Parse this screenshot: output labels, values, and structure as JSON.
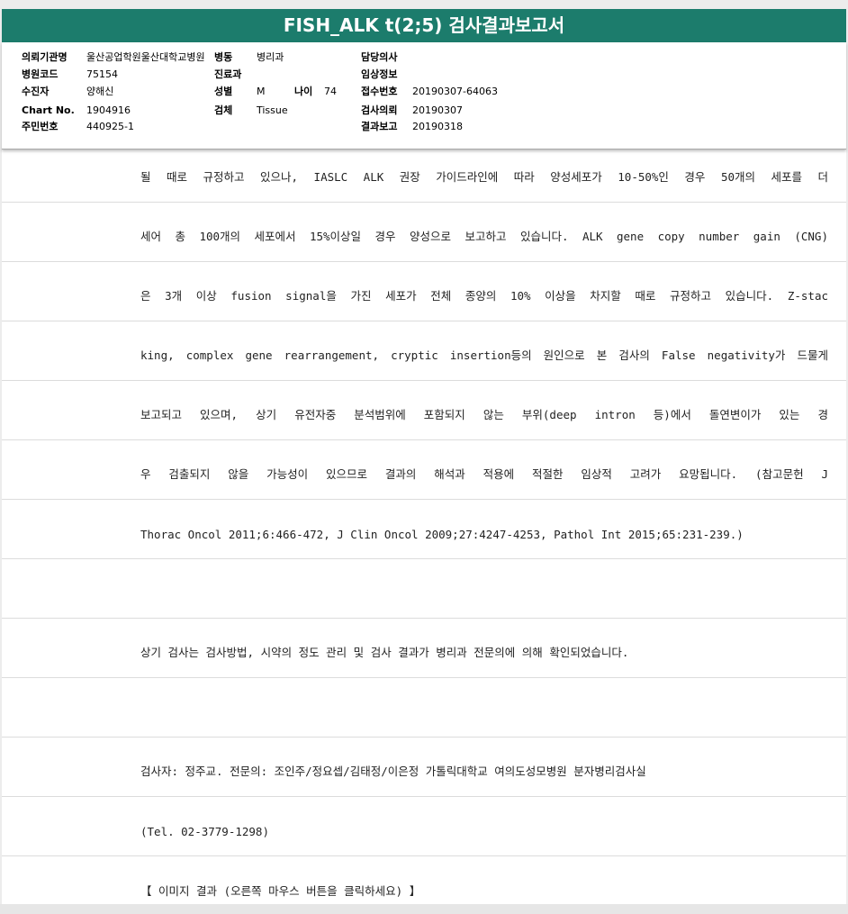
{
  "title": "FISH_ALK t(2;5) 검사결과보고서",
  "header": {
    "row1": {
      "l1": "의뢰기관명",
      "v1": "울산공업학원울산대학교병원",
      "l2": "병동",
      "v2": "병리과",
      "l3": "담당의사",
      "v3": ""
    },
    "row2": {
      "l1": "병원코드",
      "v1": "75154",
      "l2": "진료과",
      "v2": "",
      "l3": "임상정보",
      "v3": ""
    },
    "row3": {
      "l1": "수진자",
      "v1": "양해신",
      "l2": "성별",
      "v2": "M",
      "l2b": "나이",
      "v2b": "74",
      "l3": "접수번호",
      "v3": "20190307-64063"
    },
    "row4": {
      "l1": "Chart No.",
      "v1": "1904916",
      "l2": "검체",
      "v2": "Tissue",
      "l3": "검사의뢰",
      "v3": "20190307"
    },
    "row5": {
      "l1": "주민번호",
      "v1": "440925-1",
      "l3": "결과보고",
      "v3": "20190318"
    }
  },
  "lines": [
    "될 때로 규정하고 있으나, IASLC ALK 권장 가이드라인에 따라 양성세포가 10-50%인 경우 50개의 세포를 더",
    "세어 총 100개의 세포에서 15%이상일 경우 양성으로 보고하고 있습니다. ALK gene copy number gain (CNG)",
    "은 3개 이상 fusion signal을 가진 세포가 전체 종양의 10% 이상을 차지할 때로 규정하고 있습니다. Z-stac",
    "king, complex gene rearrangement, cryptic insertion등의 원인으로 본 검사의 False negativity가 드물게",
    " 보고되고 있으며, 상기 유전자중 분석범위에 포함되지 않는 부위(deep intron 등)에서 돌연변이가 있는 경",
    "우 검출되지 않을 가능성이 있으므로 결과의 해석과 적용에 적절한 임상적 고려가 요망됩니다. (참고문헌 J",
    " Thorac Oncol 2011;6:466-472, J Clin Oncol 2009;27:4247-4253,  Pathol Int 2015;65:231-239.)",
    "",
    "상기 검사는 검사방법, 시약의 정도 관리 및 검사 결과가 병리과 전문의에 의해 확인되었습니다.",
    "",
    "검사자: 정주교. 전문의: 조인주/정요셉/김태정/이은정 가톨릭대학교 여의도성모병원 분자병리검사실",
    "(Tel. 02-3779-1298)",
    "【 이미지 결과 (오른쪽 마우스 버튼을 클릭하세요) 】"
  ]
}
